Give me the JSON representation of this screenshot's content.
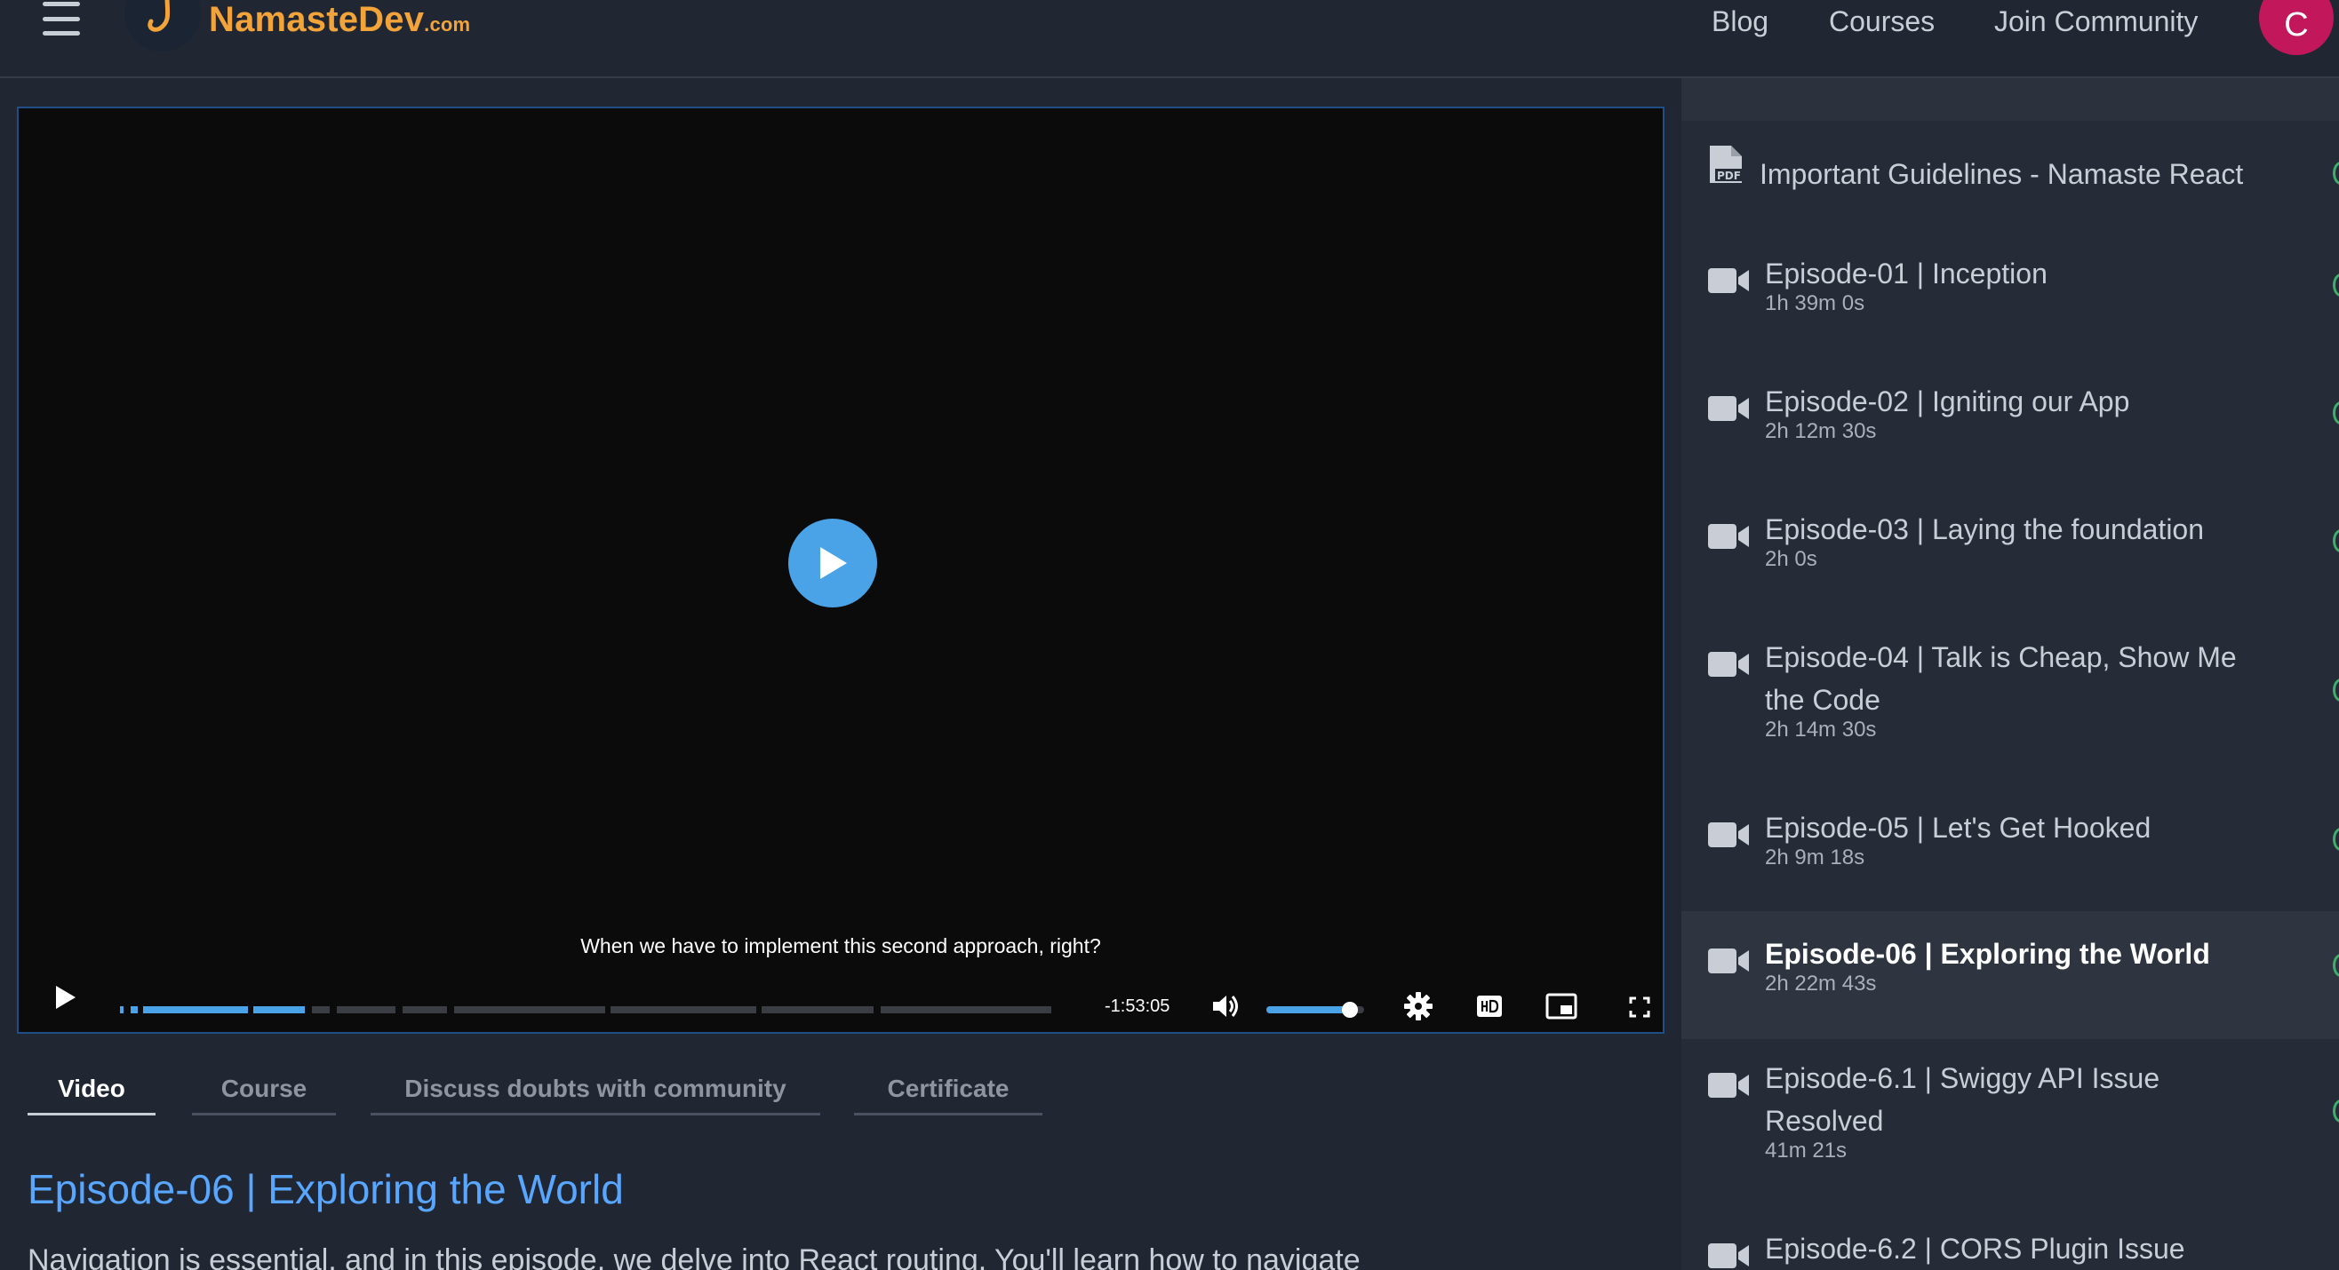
{
  "header": {
    "logo_main": "NamasteDev",
    "logo_suffix": ".com",
    "nav": [
      "Blog",
      "Courses",
      "Join Community"
    ],
    "avatar_initial": "C"
  },
  "player": {
    "caption": "When we have to implement this second approach, right?",
    "time_remaining": "-1:53:05",
    "volume_level": 0.85
  },
  "tabs": [
    "Video",
    "Course",
    "Discuss doubts with community",
    "Certificate"
  ],
  "active_tab": "Video",
  "episode": {
    "title": "Episode-06 | Exploring the World",
    "description": "Navigation is essential, and in this episode, we delve into React routing. You'll learn how to navigate"
  },
  "sidebar": {
    "items": [
      {
        "type": "pdf",
        "title": "Important Guidelines - Namaste React",
        "duration": ""
      },
      {
        "type": "video",
        "title": "Episode-01 | Inception",
        "duration": "1h 39m 0s"
      },
      {
        "type": "video",
        "title": "Episode-02 | Igniting our App",
        "duration": "2h 12m 30s"
      },
      {
        "type": "video",
        "title": "Episode-03 | Laying the foundation",
        "duration": "2h 0s"
      },
      {
        "type": "video",
        "title": "Episode-04 | Talk is Cheap, Show Me the Code",
        "duration": "2h 14m 30s"
      },
      {
        "type": "video",
        "title": "Episode-05 | Let's Get Hooked",
        "duration": "2h 9m 18s"
      },
      {
        "type": "video",
        "title": "Episode-06 | Exploring the World",
        "duration": "2h 22m 43s",
        "active": true
      },
      {
        "type": "video",
        "title": "Episode-6.1 | Swiggy API Issue Resolved",
        "duration": "41m 21s"
      },
      {
        "type": "video",
        "title": "Episode-6.2 | CORS Plugin Issue",
        "duration": ""
      }
    ]
  },
  "colors": {
    "accent": "#4aa3e6",
    "title_blue": "#58a6ff",
    "logo_orange": "#f2a33a",
    "avatar": "#c2185b",
    "completed": "#3fae6a"
  }
}
